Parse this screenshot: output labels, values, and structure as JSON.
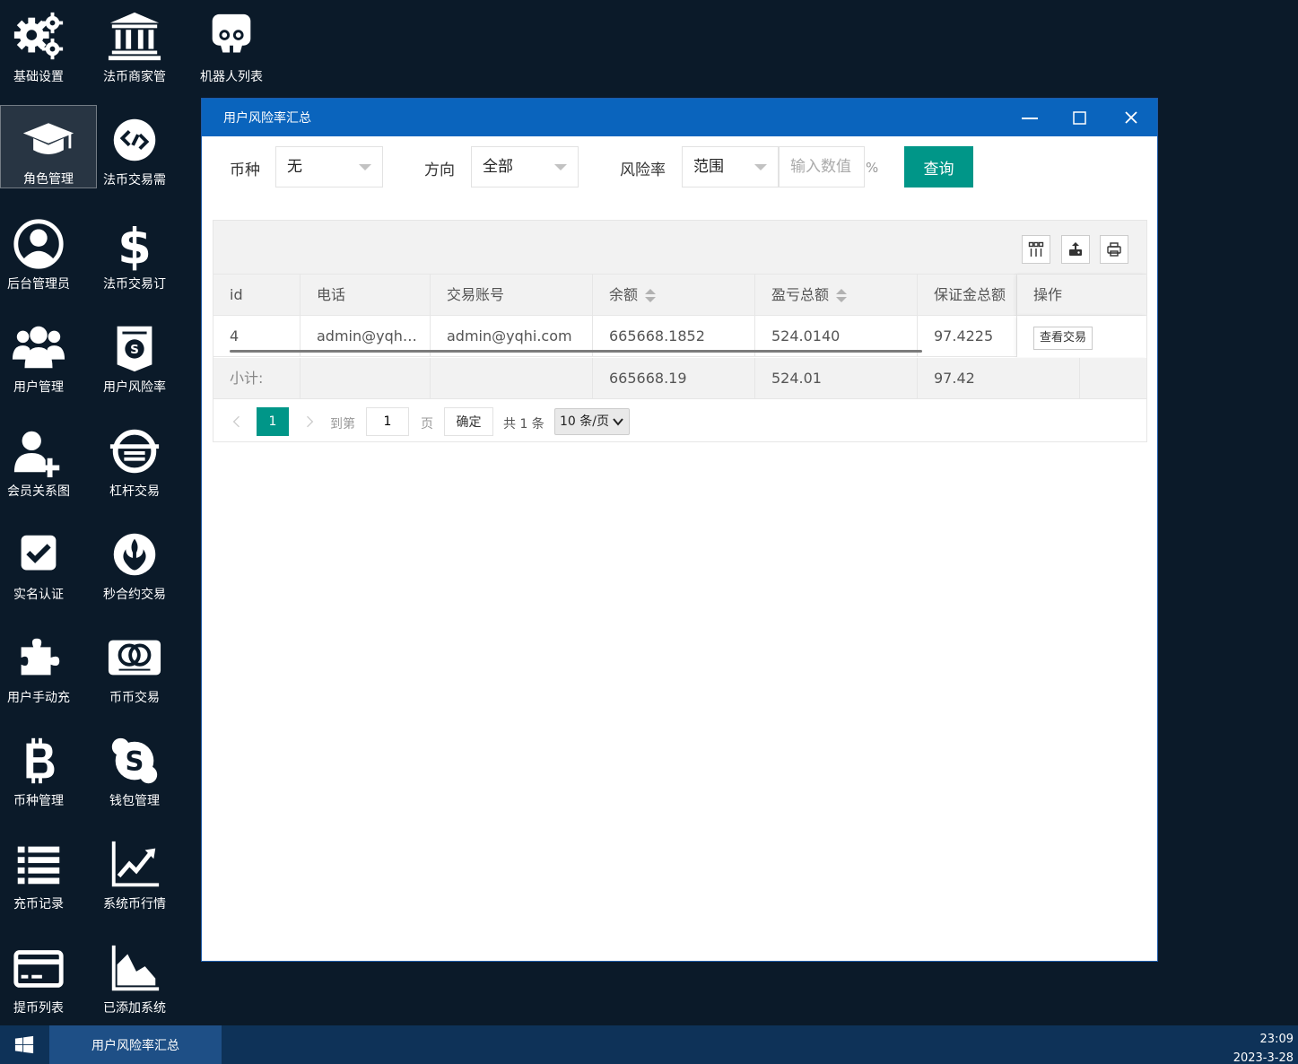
{
  "desktop": {
    "icons": [
      {
        "label": "基础设置",
        "icon": "gears-icon"
      },
      {
        "label": "法币商家管",
        "icon": "bank-icon"
      },
      {
        "label": "机器人列表",
        "icon": "robot-icon"
      },
      {
        "label": "角色管理",
        "icon": "graduation-cap-icon"
      },
      {
        "label": "法币交易需",
        "icon": "exchange-icon"
      },
      {
        "label": "后台管理员",
        "icon": "user-circle-icon"
      },
      {
        "label": "法币交易订",
        "icon": "dollar-icon"
      },
      {
        "label": "用户管理",
        "icon": "users-icon"
      },
      {
        "label": "用户风险率",
        "icon": "shield-coin-icon"
      },
      {
        "label": "会员关系图",
        "icon": "user-plus-icon"
      },
      {
        "label": "杠杆交易",
        "icon": "leverage-icon"
      },
      {
        "label": "实名认证",
        "icon": "check-square-icon"
      },
      {
        "label": "秒合约交易",
        "icon": "rebel-icon"
      },
      {
        "label": "用户手动充",
        "icon": "puzzle-icon"
      },
      {
        "label": "币币交易",
        "icon": "mastercard-icon"
      },
      {
        "label": "币种管理",
        "icon": "bitcoin-icon"
      },
      {
        "label": "钱包管理",
        "icon": "skype-icon"
      },
      {
        "label": "充币记录",
        "icon": "list-icon"
      },
      {
        "label": "系统币行情",
        "icon": "line-chart-icon"
      },
      {
        "label": "提币列表",
        "icon": "credit-card-icon"
      },
      {
        "label": "已添加系统",
        "icon": "area-chart-icon"
      }
    ]
  },
  "window": {
    "title": "用户风险率汇总"
  },
  "filters": {
    "currency_label": "币种",
    "currency_value": "无",
    "direction_label": "方向",
    "direction_value": "全部",
    "risk_label": "风险率",
    "risk_range_value": "范围",
    "risk_input_placeholder": "输入数值",
    "percent": "%",
    "query_button": "查询"
  },
  "table": {
    "columns": [
      "id",
      "电话",
      "交易账号",
      "余额",
      "盈亏总额",
      "保证金总额",
      "操作"
    ],
    "rows": [
      {
        "id": "4",
        "phone": "admin@yqh…",
        "account": "admin@yqhi.com",
        "balance": "665668.1852",
        "pnl": "524.0140",
        "margin": "97.4225",
        "action": "查看交易"
      }
    ],
    "totals": {
      "label": "小计:",
      "balance": "665668.19",
      "pnl": "524.01",
      "margin": "97.42"
    }
  },
  "pager": {
    "current_page": "1",
    "goto_label": "到第",
    "goto_value": "1",
    "page_unit": "页",
    "confirm": "确定",
    "total": "共 1 条",
    "page_size": "10 条/页"
  },
  "taskbar": {
    "active_task": "用户风险率汇总",
    "time": "23:09",
    "date": "2023-3-28"
  }
}
